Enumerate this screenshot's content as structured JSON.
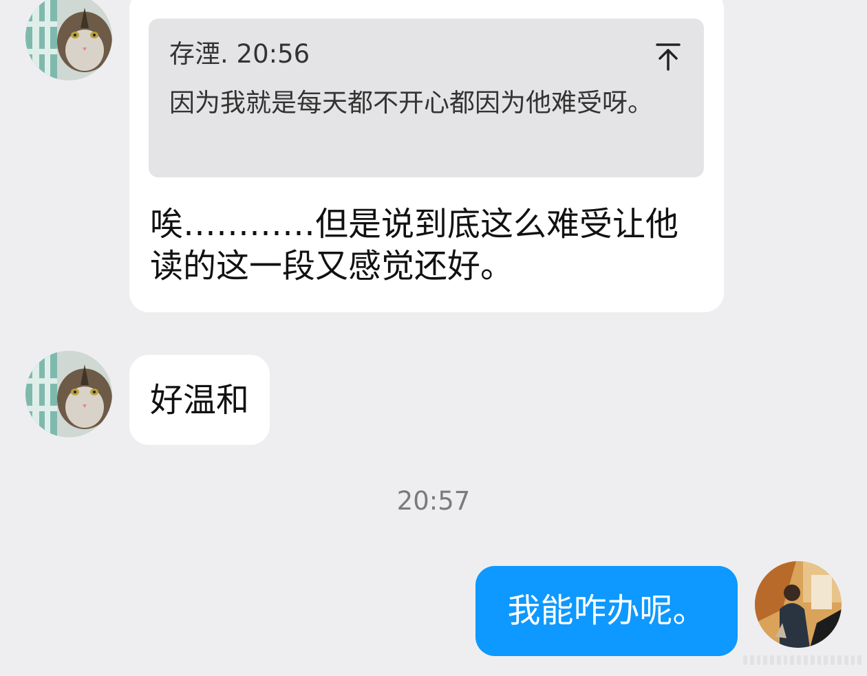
{
  "messages": {
    "quoted": {
      "sender_time": "存湮. 20:56",
      "text": "因为我就是每天都不开心都因为他难受呀。"
    },
    "reply": "唉…………但是说到底这么难受让他读的这一段又感觉还好。",
    "second": "好温和",
    "divider_time": "20:57",
    "outgoing": "我能咋办呢。"
  },
  "icons": {
    "scroll_top": "scroll-to-top-icon",
    "avatar_incoming": "cat-avatar",
    "avatar_outgoing": "user-photo-avatar"
  },
  "colors": {
    "background": "#eeeef0",
    "incoming_bubble": "#ffffff",
    "quote_box": "#e4e4e6",
    "outgoing_bubble": "#0d99ff",
    "timestamp": "#7a7a7a"
  }
}
